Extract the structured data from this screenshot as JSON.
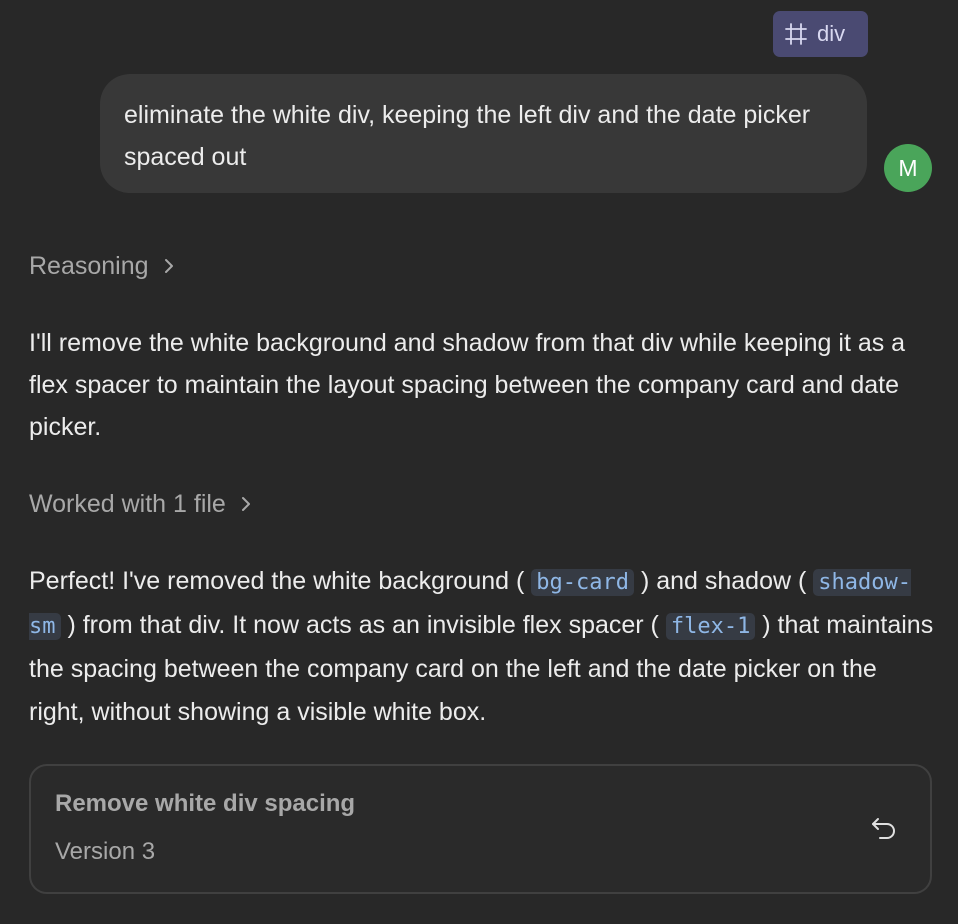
{
  "context_chip": {
    "icon": "hash-frame-icon",
    "label": "div"
  },
  "user_message": {
    "text": "eliminate the white div, keeping the left div and the date picker spaced out",
    "avatar_initial": "M",
    "avatar_color": "#4aa55a"
  },
  "reasoning": {
    "label": "Reasoning"
  },
  "assistant_intro": {
    "text": "I'll remove the white background and shadow from that div while keeping it as a flex spacer to maintain the layout spacing between the company card and date picker."
  },
  "worked_files": {
    "label": "Worked with 1 file"
  },
  "assistant_result": {
    "t1": "Perfect! I've removed the white background (",
    "c1": "bg-card",
    "t2": ") and shadow (",
    "c2": "shadow-sm",
    "t3": ") from that div. It now acts as an invisible flex spacer (",
    "c3": "flex-1",
    "t4": ") that maintains the spacing between the company card on the left and the date picker on the right, without showing a visible white box."
  },
  "version_card": {
    "title": "Remove white div spacing",
    "version": "Version 3",
    "action_icon": "undo-icon"
  }
}
